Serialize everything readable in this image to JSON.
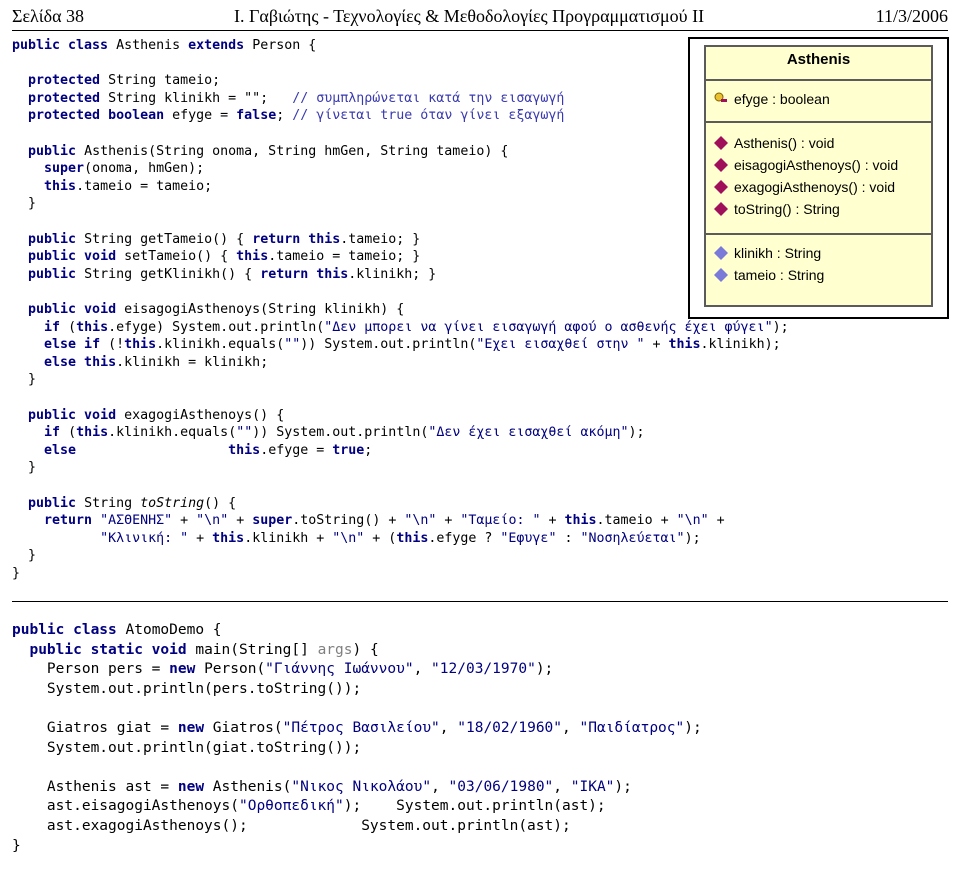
{
  "header": {
    "left": "Σελίδα 38",
    "center": "Ι. Γαβιώτης - Τεχνολογίες & Μεθοδολογίες Προγραμματισμού ΙΙ",
    "right": "11/3/2006"
  },
  "uml": {
    "class_name": "Asthenis",
    "attributes_top": [
      "efyge : boolean"
    ],
    "methods": [
      "Asthenis() : void",
      "eisagogiAsthenoys() : void",
      "exagogiAsthenoys() : void",
      "toString() : String"
    ],
    "attributes_bottom": [
      "klinikh : String",
      "tameio : String"
    ]
  },
  "code1": [
    {
      "t": [
        [
          "kw",
          "public class "
        ],
        [
          "",
          "Asthenis "
        ],
        [
          "kw",
          "extends "
        ],
        [
          "",
          "Person {"
        ]
      ]
    },
    {
      "t": []
    },
    {
      "t": [
        [
          "",
          "  "
        ],
        [
          "kw",
          "protected "
        ],
        [
          "",
          "String tameio;"
        ]
      ]
    },
    {
      "t": [
        [
          "",
          "  "
        ],
        [
          "kw",
          "protected "
        ],
        [
          "",
          "String klinikh = \"\";   "
        ],
        [
          "cm",
          "// συμπληρώνεται κατά την εισαγωγή"
        ]
      ]
    },
    {
      "t": [
        [
          "",
          "  "
        ],
        [
          "kw",
          "protected boolean "
        ],
        [
          "",
          "efyge = "
        ],
        [
          "kw",
          "false"
        ],
        [
          "",
          "; "
        ],
        [
          "cm",
          "// γίνεται true όταν γίνει εξαγωγή"
        ]
      ]
    },
    {
      "t": []
    },
    {
      "t": [
        [
          "",
          "  "
        ],
        [
          "kw",
          "public "
        ],
        [
          "",
          "Asthenis(String onoma, String hmGen, String tameio) {"
        ]
      ]
    },
    {
      "t": [
        [
          "",
          "    "
        ],
        [
          "kw",
          "super"
        ],
        [
          "",
          "(onoma, hmGen);"
        ]
      ]
    },
    {
      "t": [
        [
          "",
          "    "
        ],
        [
          "kw",
          "this"
        ],
        [
          "",
          ".tameio = tameio;"
        ]
      ]
    },
    {
      "t": [
        [
          "",
          "  }"
        ]
      ]
    },
    {
      "t": []
    },
    {
      "t": [
        [
          "",
          "  "
        ],
        [
          "kw",
          "public "
        ],
        [
          "",
          "String getTameio() { "
        ],
        [
          "kw",
          "return this"
        ],
        [
          "",
          ".tameio; }"
        ]
      ]
    },
    {
      "t": [
        [
          "",
          "  "
        ],
        [
          "kw",
          "public void "
        ],
        [
          "",
          "setTameio() { "
        ],
        [
          "kw",
          "this"
        ],
        [
          "",
          ".tameio = tameio; }"
        ]
      ]
    },
    {
      "t": [
        [
          "",
          "  "
        ],
        [
          "kw",
          "public "
        ],
        [
          "",
          "String getKlinikh() { "
        ],
        [
          "kw",
          "return this"
        ],
        [
          "",
          ".klinikh; }"
        ]
      ]
    },
    {
      "t": []
    },
    {
      "t": [
        [
          "",
          "  "
        ],
        [
          "kw",
          "public void "
        ],
        [
          "",
          "eisagogiAsthenoys(String klinikh) {"
        ]
      ]
    },
    {
      "t": [
        [
          "",
          "    "
        ],
        [
          "kw",
          "if "
        ],
        [
          "",
          "("
        ],
        [
          "kw",
          "this"
        ],
        [
          "",
          ".efyge) System.out.println("
        ],
        [
          "st",
          "\"Δεν μπορει να γίνει εισαγωγή αφού ο ασθενής έχει φύγει\""
        ],
        [
          "",
          ");"
        ]
      ]
    },
    {
      "t": [
        [
          "",
          "    "
        ],
        [
          "kw",
          "else if "
        ],
        [
          "",
          "(!"
        ],
        [
          "kw",
          "this"
        ],
        [
          "",
          ".klinikh.equals("
        ],
        [
          "st",
          "\"\""
        ],
        [
          "",
          ")) System.out.println("
        ],
        [
          "st",
          "\"Εχει εισαχθεί στην \""
        ],
        [
          "",
          " + "
        ],
        [
          "kw",
          "this"
        ],
        [
          "",
          ".klinikh);"
        ]
      ]
    },
    {
      "t": [
        [
          "",
          "    "
        ],
        [
          "kw",
          "else this"
        ],
        [
          "",
          ".klinikh = klinikh;"
        ]
      ]
    },
    {
      "t": [
        [
          "",
          "  }"
        ]
      ]
    },
    {
      "t": []
    },
    {
      "t": [
        [
          "",
          "  "
        ],
        [
          "kw",
          "public void "
        ],
        [
          "",
          "exagogiAsthenoys() {"
        ]
      ]
    },
    {
      "t": [
        [
          "",
          "    "
        ],
        [
          "kw",
          "if "
        ],
        [
          "",
          "("
        ],
        [
          "kw",
          "this"
        ],
        [
          "",
          ".klinikh.equals("
        ],
        [
          "st",
          "\"\""
        ],
        [
          "",
          ")) System.out.println("
        ],
        [
          "st",
          "\"Δεν έχει εισαχθεί ακόμη\""
        ],
        [
          "",
          ");"
        ]
      ]
    },
    {
      "t": [
        [
          "",
          "    "
        ],
        [
          "kw",
          "else                   this"
        ],
        [
          "",
          ".efyge = "
        ],
        [
          "kw",
          "true"
        ],
        [
          "",
          ";"
        ]
      ]
    },
    {
      "t": [
        [
          "",
          "  }"
        ]
      ]
    },
    {
      "t": []
    },
    {
      "t": [
        [
          "",
          "  "
        ],
        [
          "kw",
          "public "
        ],
        [
          "",
          "String "
        ],
        [
          "it",
          "toString"
        ],
        [
          "",
          "() {"
        ]
      ]
    },
    {
      "t": [
        [
          "",
          "    "
        ],
        [
          "kw",
          "return "
        ],
        [
          "st",
          "\"ΑΣΘΕΝΗΣ\""
        ],
        [
          "",
          " + "
        ],
        [
          "st",
          "\"\\n\""
        ],
        [
          "",
          " + "
        ],
        [
          "kw",
          "super"
        ],
        [
          "",
          ".toString() + "
        ],
        [
          "st",
          "\"\\n\""
        ],
        [
          "",
          " + "
        ],
        [
          "st",
          "\"Ταμείο: \""
        ],
        [
          "",
          " + "
        ],
        [
          "kw",
          "this"
        ],
        [
          "",
          ".tameio + "
        ],
        [
          "st",
          "\"\\n\""
        ],
        [
          "",
          " +"
        ]
      ]
    },
    {
      "t": [
        [
          "",
          "           "
        ],
        [
          "st",
          "\"Κλινική: \""
        ],
        [
          "",
          " + "
        ],
        [
          "kw",
          "this"
        ],
        [
          "",
          ".klinikh + "
        ],
        [
          "st",
          "\"\\n\""
        ],
        [
          "",
          " + ("
        ],
        [
          "kw",
          "this"
        ],
        [
          "",
          ".efyge ? "
        ],
        [
          "st",
          "\"Εφυγε\""
        ],
        [
          "",
          " : "
        ],
        [
          "st",
          "\"Νοσηλεύεται\""
        ],
        [
          "",
          ");"
        ]
      ]
    },
    {
      "t": [
        [
          "",
          "  }"
        ]
      ]
    },
    {
      "t": [
        [
          "",
          "}"
        ]
      ]
    }
  ],
  "code2": [
    {
      "t": [
        [
          "kw",
          "public class "
        ],
        [
          "",
          "AtomoDemo {"
        ]
      ]
    },
    {
      "t": [
        [
          "",
          "  "
        ],
        [
          "kw",
          "public static void "
        ],
        [
          "",
          "main(String[] "
        ],
        [
          "gr",
          "args"
        ],
        [
          "",
          ") {"
        ]
      ]
    },
    {
      "t": [
        [
          "",
          "    Person pers = "
        ],
        [
          "kw",
          "new "
        ],
        [
          "",
          "Person("
        ],
        [
          "st",
          "\"Γιάννης Ιωάννου\""
        ],
        [
          "",
          ", "
        ],
        [
          "st",
          "\"12/03/1970\""
        ],
        [
          "",
          ");"
        ]
      ]
    },
    {
      "t": [
        [
          "",
          "    System.out.println(pers.toString());"
        ]
      ]
    },
    {
      "t": []
    },
    {
      "t": [
        [
          "",
          "    Giatros giat = "
        ],
        [
          "kw",
          "new "
        ],
        [
          "",
          "Giatros("
        ],
        [
          "st",
          "\"Πέτρος Βασιλείου\""
        ],
        [
          "",
          ", "
        ],
        [
          "st",
          "\"18/02/1960\""
        ],
        [
          "",
          ", "
        ],
        [
          "st",
          "\"Παιδίατρος\""
        ],
        [
          "",
          ");"
        ]
      ]
    },
    {
      "t": [
        [
          "",
          "    System.out.println(giat.toString());"
        ]
      ]
    },
    {
      "t": []
    },
    {
      "t": [
        [
          "",
          "    Asthenis ast = "
        ],
        [
          "kw",
          "new "
        ],
        [
          "",
          "Asthenis("
        ],
        [
          "st",
          "\"Νικος Νικολάου\""
        ],
        [
          "",
          ", "
        ],
        [
          "st",
          "\"03/06/1980\""
        ],
        [
          "",
          ", "
        ],
        [
          "st",
          "\"ΙΚΑ\""
        ],
        [
          "",
          ");"
        ]
      ]
    },
    {
      "t": [
        [
          "",
          "    ast.eisagogiAsthenoys("
        ],
        [
          "st",
          "\"Ορθοπεδική\""
        ],
        [
          "",
          ");    System.out.println(ast);"
        ]
      ]
    },
    {
      "t": [
        [
          "",
          "    ast.exagogiAsthenoys();             System.out.println(ast);"
        ]
      ]
    },
    {
      "t": [
        [
          "",
          "}"
        ]
      ]
    }
  ],
  "icons": {
    "field": "field-key-icon",
    "method": "method-diamond-icon",
    "attr": "attribute-diamond-icon"
  },
  "colors": {
    "keyword": "#000080",
    "comment": "#3a3ab0",
    "uml_bg": "#ffffd0",
    "method_icon": "#a0105a",
    "attr_icon": "#7a7ad8"
  }
}
